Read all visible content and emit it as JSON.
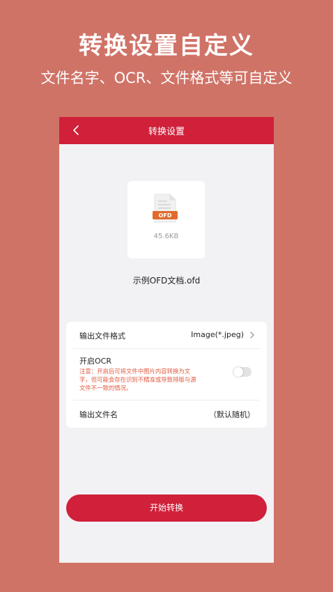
{
  "promo": {
    "title": "转换设置自定义",
    "subtitle": "文件名字、OCR、文件格式等可自定义"
  },
  "header": {
    "title": "转换设置",
    "back_icon": "chevron-left-icon"
  },
  "file": {
    "icon": "ofd-file-icon",
    "icon_label": "OFD",
    "size": "45.6KB",
    "name": "示例OFD文档.ofd"
  },
  "settings": {
    "output_format_label": "输出文件格式",
    "output_format_value": "Image(*.jpeg)",
    "ocr_label": "开启OCR",
    "ocr_note_lines": [
      "注意：开启后可将文件中图片内容转换为文",
      "字，但可能会存在识别不精准或导致排版与源",
      "文件不一致的情况。"
    ],
    "ocr_enabled": false,
    "output_name_label": "输出文件名",
    "output_name_value": "（默认随机）"
  },
  "actions": {
    "start_label": "开始转换"
  },
  "colors": {
    "background": "#d07367",
    "accent": "#d0203a",
    "note": "#e15b3f",
    "ofd_badge": "#e06b2d"
  }
}
